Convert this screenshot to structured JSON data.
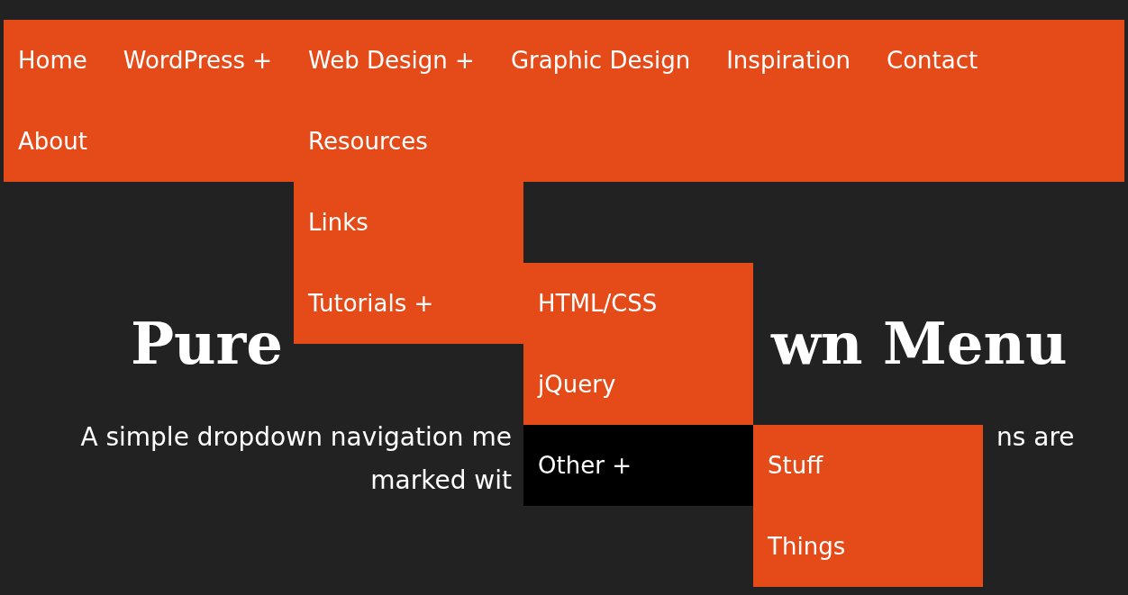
{
  "menu_rows": [
    [
      {
        "label": "Home",
        "active": false
      },
      {
        "label": "WordPress +",
        "active": false
      },
      {
        "label": "Web Design +",
        "active": false,
        "children": [
          {
            "label": "Resources",
            "active": false
          },
          {
            "label": "Links",
            "active": false
          },
          {
            "label": "Tutorials +",
            "active": false,
            "children": [
              {
                "label": "HTML/CSS",
                "active": false
              },
              {
                "label": "jQuery",
                "active": false
              },
              {
                "label": "Other +",
                "active": true,
                "children": [
                  {
                    "label": "Stuff",
                    "active": false
                  },
                  {
                    "label": "Things",
                    "active": false
                  }
                ]
              }
            ]
          }
        ]
      },
      {
        "label": "Graphic Design",
        "active": false
      },
      {
        "label": "Inspiration",
        "active": false
      },
      {
        "label": "Contact",
        "active": false
      }
    ],
    [
      {
        "label": "About",
        "active": false
      }
    ]
  ],
  "heading": {
    "parts": [
      "Pure",
      "wn Menu"
    ]
  },
  "intro": {
    "lines": [
      [
        "A simple dropdown navigation me",
        "ns are"
      ],
      [
        "marked wit"
      ]
    ]
  }
}
